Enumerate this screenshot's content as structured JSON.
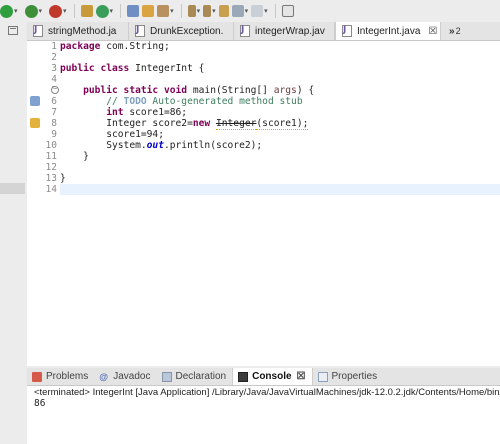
{
  "editor_tabs": [
    {
      "label": "stringMethod.ja",
      "active": false
    },
    {
      "label": "DrunkException.",
      "active": false
    },
    {
      "label": "integerWrap.jav",
      "active": false
    },
    {
      "label": "IntegerInt.java",
      "active": true
    }
  ],
  "tab_close_glyph": "☒",
  "overflow": {
    "glyph": "»",
    "count": "2"
  },
  "line_numbers": [
    "1",
    "2",
    "3",
    "4",
    "5",
    "6",
    "7",
    "8",
    "9",
    "10",
    "11",
    "12",
    "13",
    "14"
  ],
  "code": {
    "l1_kw": "package",
    "l1_rest": " com.String;",
    "l3_kw1": "public",
    "l3_kw2": "class",
    "l3_rest": " IntegerInt {",
    "l5_kw1": "public",
    "l5_kw2": "static",
    "l5_kw3": "void",
    "l5_rest1": " main(String[] ",
    "l5_args": "args",
    "l5_rest2": ") {",
    "l6_pre": "// ",
    "l6_todo": "TODO",
    "l6_rest": " Auto-generated method stub",
    "l7_kw": "int",
    "l7_rest": " score1=86;",
    "l8_pre": "Integer score2=",
    "l8_kw": "new",
    "l8_dep": "Integer",
    "l8_rest": "(score1);",
    "l9": "score1=94;",
    "l10_pre": "System.",
    "l10_fld": "out",
    "l10_rest": ".println(score2);",
    "l11": "}",
    "l13": "}"
  },
  "panel_tabs": [
    {
      "label": "Problems",
      "icon": "problems-icon",
      "active": false
    },
    {
      "label": "Javadoc",
      "icon": "javadoc-icon",
      "active": false
    },
    {
      "label": "Declaration",
      "icon": "declaration-icon",
      "active": false
    },
    {
      "label": "Console",
      "icon": "console-icon",
      "active": true
    },
    {
      "label": "Properties",
      "icon": "properties-icon",
      "active": false
    }
  ],
  "console": {
    "terminated": "<terminated> IntegerInt [Java Application] /Library/Java/JavaVirtualMachines/jdk-12.0.2.jdk/Contents/Home/bin/java (",
    "output": "86"
  },
  "colors": {
    "keyword": "#7f0055",
    "comment": "#3f7f5f",
    "field": "#0000c0",
    "current_line": "#e8f2fe",
    "run_green": "#2f9e3f",
    "debug_green": "#3f8f3a"
  }
}
